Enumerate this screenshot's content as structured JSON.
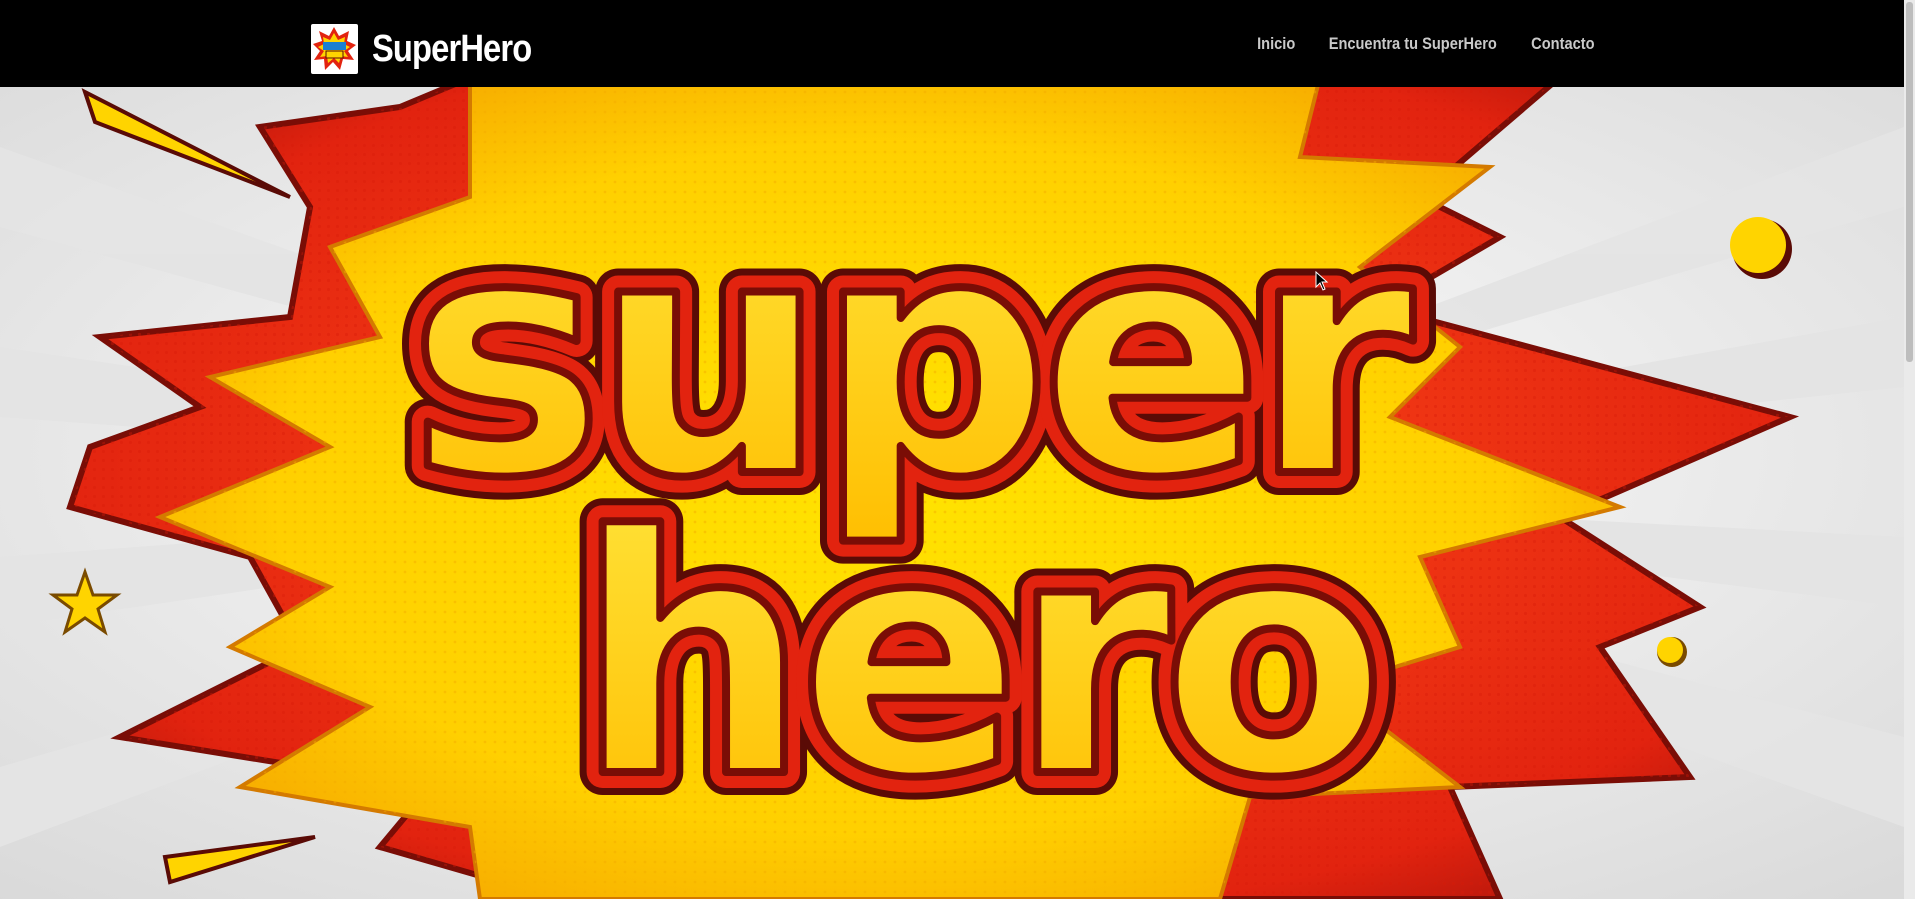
{
  "navbar": {
    "brand_name": "SuperHero",
    "brand_logo_icon": "superhero-comic-logo-icon",
    "links": [
      {
        "label": "Inicio"
      },
      {
        "label": "Encuentra tu SuperHero"
      },
      {
        "label": "Contacto"
      }
    ]
  },
  "hero": {
    "banner_word_top": "super",
    "banner_word_bottom": "hero",
    "background_icon": "comic-explosion-burst-icon"
  },
  "colors": {
    "navbar_bg": "#000000",
    "nav_link": "#c9c9c9",
    "burst_yellow": "#ffd400",
    "burst_red": "#e2230f",
    "outline_dark": "#5a0b06"
  }
}
